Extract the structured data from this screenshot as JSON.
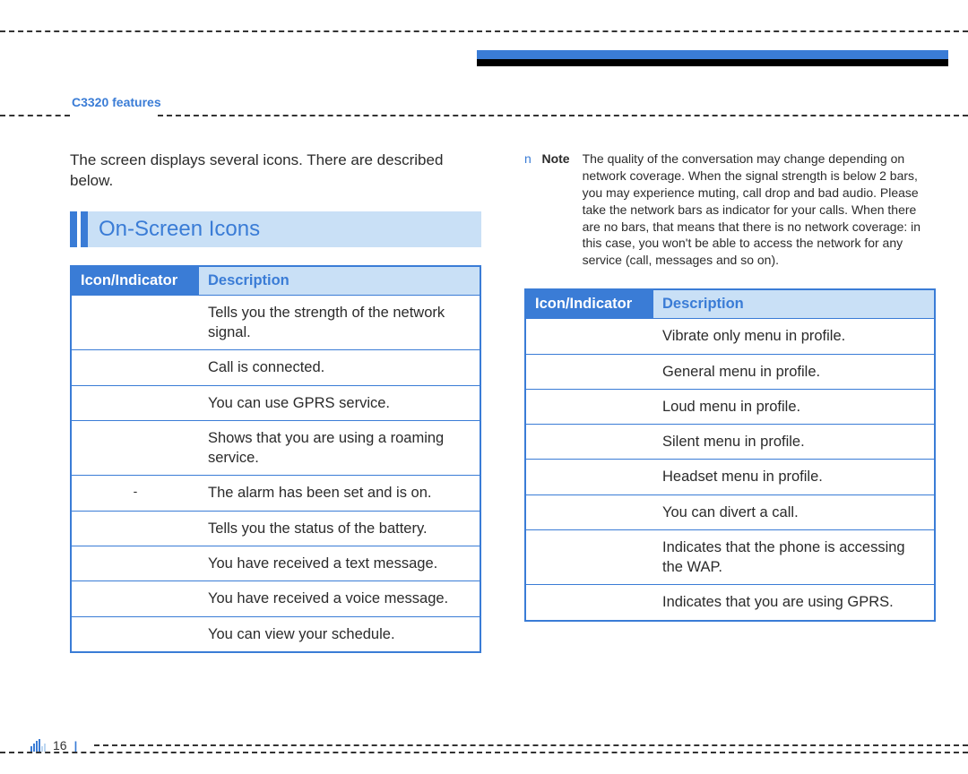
{
  "header": {
    "product_label": "C3320 features"
  },
  "page_number": "16",
  "left": {
    "intro": "The screen displays several icons. There are described below.",
    "section_title": "On-Screen Icons",
    "table_header": {
      "icon": "Icon/Indicator",
      "desc": "Description"
    },
    "rows": [
      {
        "icon": "",
        "desc": "Tells you the strength of the network signal."
      },
      {
        "icon": "",
        "desc": "Call is connected."
      },
      {
        "icon": "",
        "desc": "You can use GPRS service."
      },
      {
        "icon": "",
        "desc": "Shows that you are using a roaming service."
      },
      {
        "icon": "-",
        "desc": "The alarm has been set and is on."
      },
      {
        "icon": "",
        "desc": "Tells you the status of the battery."
      },
      {
        "icon": "",
        "desc": "You have received a text message."
      },
      {
        "icon": "",
        "desc": "You have received a voice message."
      },
      {
        "icon": "",
        "desc": "You can view your schedule."
      }
    ]
  },
  "right": {
    "note_mark": "n",
    "note_label": "Note",
    "note_body": "The quality of the conversation may change depending on network coverage. When the signal strength is below 2 bars, you may experience muting, call drop and bad audio. Please take the network bars as indicator for your calls. When there are no bars, that means that there is no network coverage: in this case, you won't be able to access the network for any service (call, messages and so on).",
    "table_header": {
      "icon": "Icon/Indicator",
      "desc": "Description"
    },
    "rows": [
      {
        "icon": "",
        "desc": "Vibrate only menu in profile."
      },
      {
        "icon": "",
        "desc": "General menu in profile."
      },
      {
        "icon": "",
        "desc": "Loud menu in profile."
      },
      {
        "icon": "",
        "desc": "Silent menu in profile."
      },
      {
        "icon": "",
        "desc": "Headset menu in profile."
      },
      {
        "icon": "",
        "desc": "You can divert a call."
      },
      {
        "icon": "",
        "desc": "Indicates that the phone is accessing the WAP."
      },
      {
        "icon": "",
        "desc": "Indicates that you are using GPRS."
      }
    ]
  }
}
